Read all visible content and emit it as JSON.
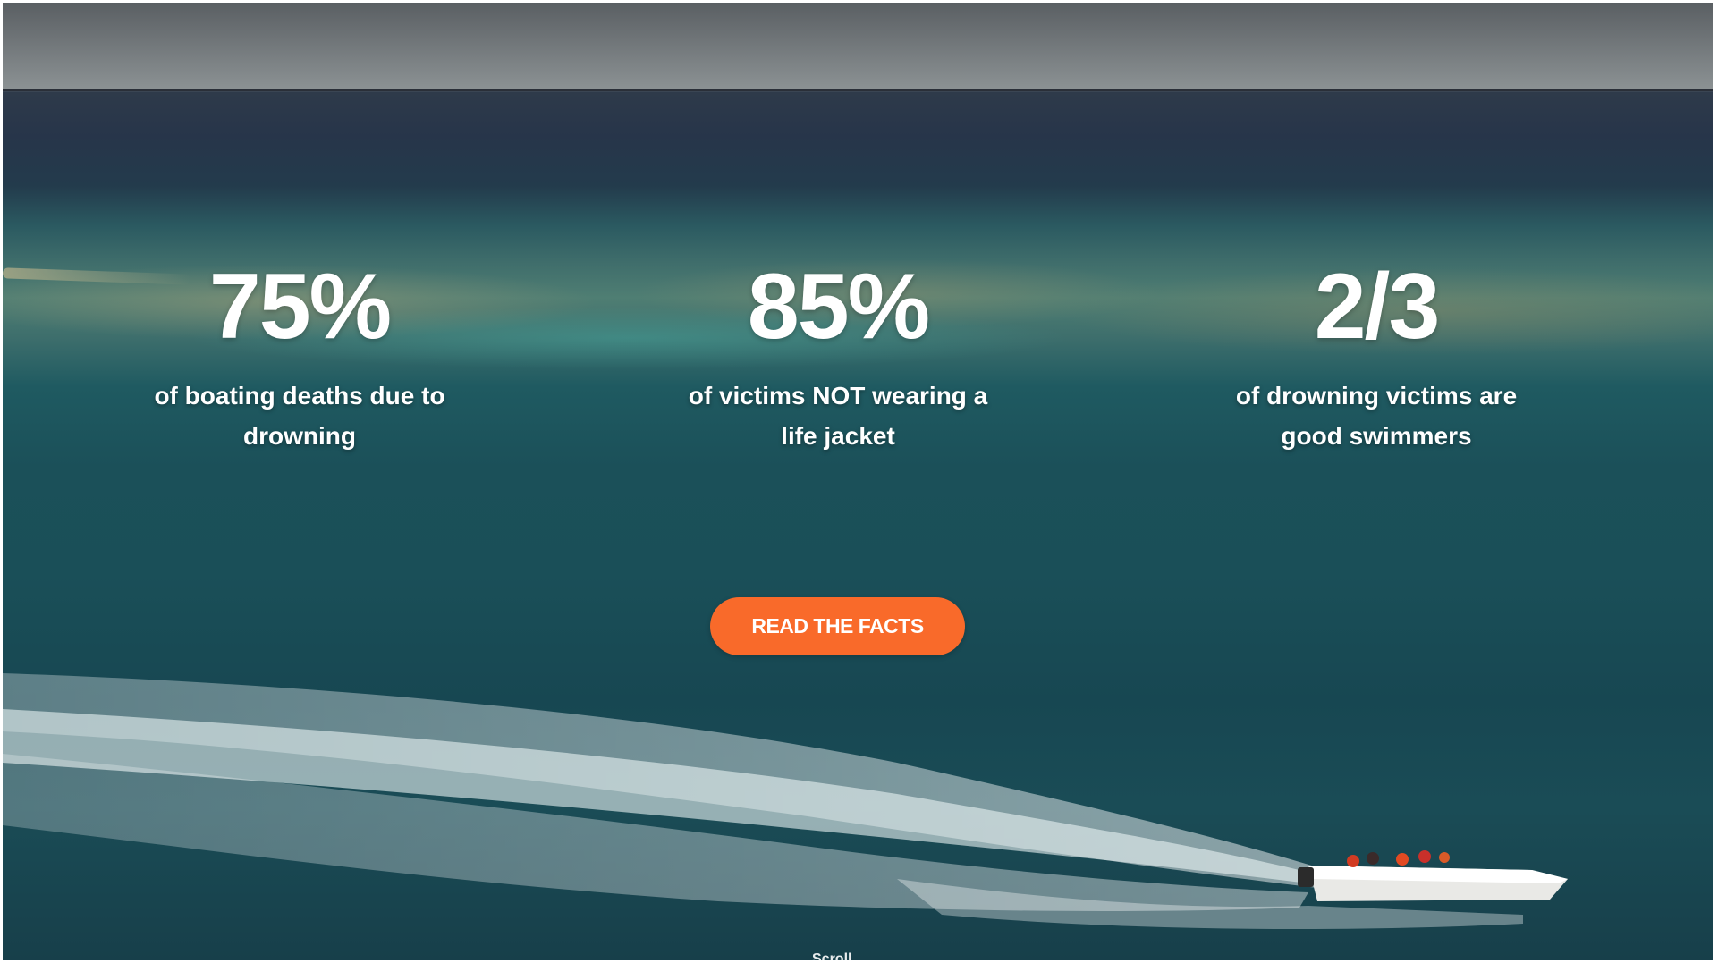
{
  "hero": {
    "stats": [
      {
        "value": "75%",
        "description": "of boating deaths due to drowning"
      },
      {
        "value": "85%",
        "description": "of victims NOT wearing a life jacket"
      },
      {
        "value": "2/3",
        "description": "of drowning victims are good swimmers"
      }
    ],
    "cta_label": "READ THE FACTS",
    "scroll_label": "Scroll"
  },
  "colors": {
    "accent": "#f96a2a",
    "text": "#ffffff",
    "ocean": "#1a4f58"
  }
}
